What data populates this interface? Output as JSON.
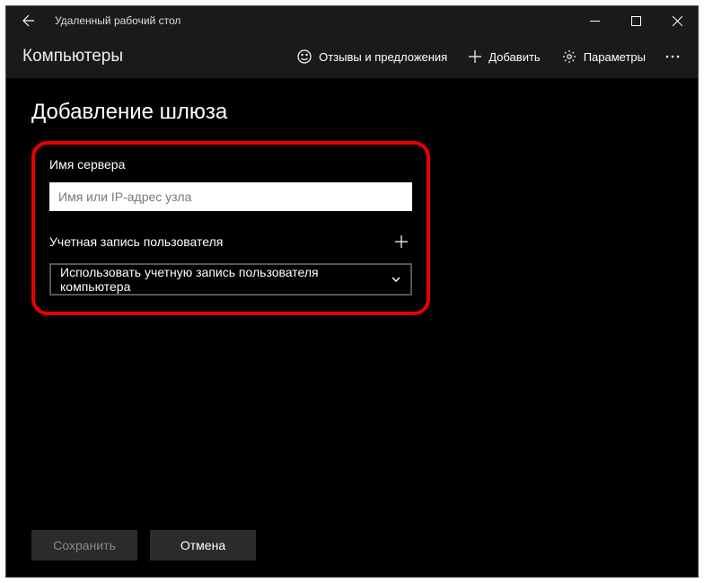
{
  "titlebar": {
    "title": "Удаленный рабочий стол"
  },
  "toolbar": {
    "heading": "Компьютеры",
    "feedback": "Отзывы и предложения",
    "add": "Добавить",
    "settings": "Параметры"
  },
  "page": {
    "heading": "Добавление шлюза",
    "server_label": "Имя сервера",
    "server_placeholder": "Имя или IP-адрес узла",
    "server_value": "",
    "account_label": "Учетная запись пользователя",
    "account_selected": "Использовать учетную запись пользователя компьютера"
  },
  "footer": {
    "save": "Сохранить",
    "cancel": "Отмена"
  }
}
